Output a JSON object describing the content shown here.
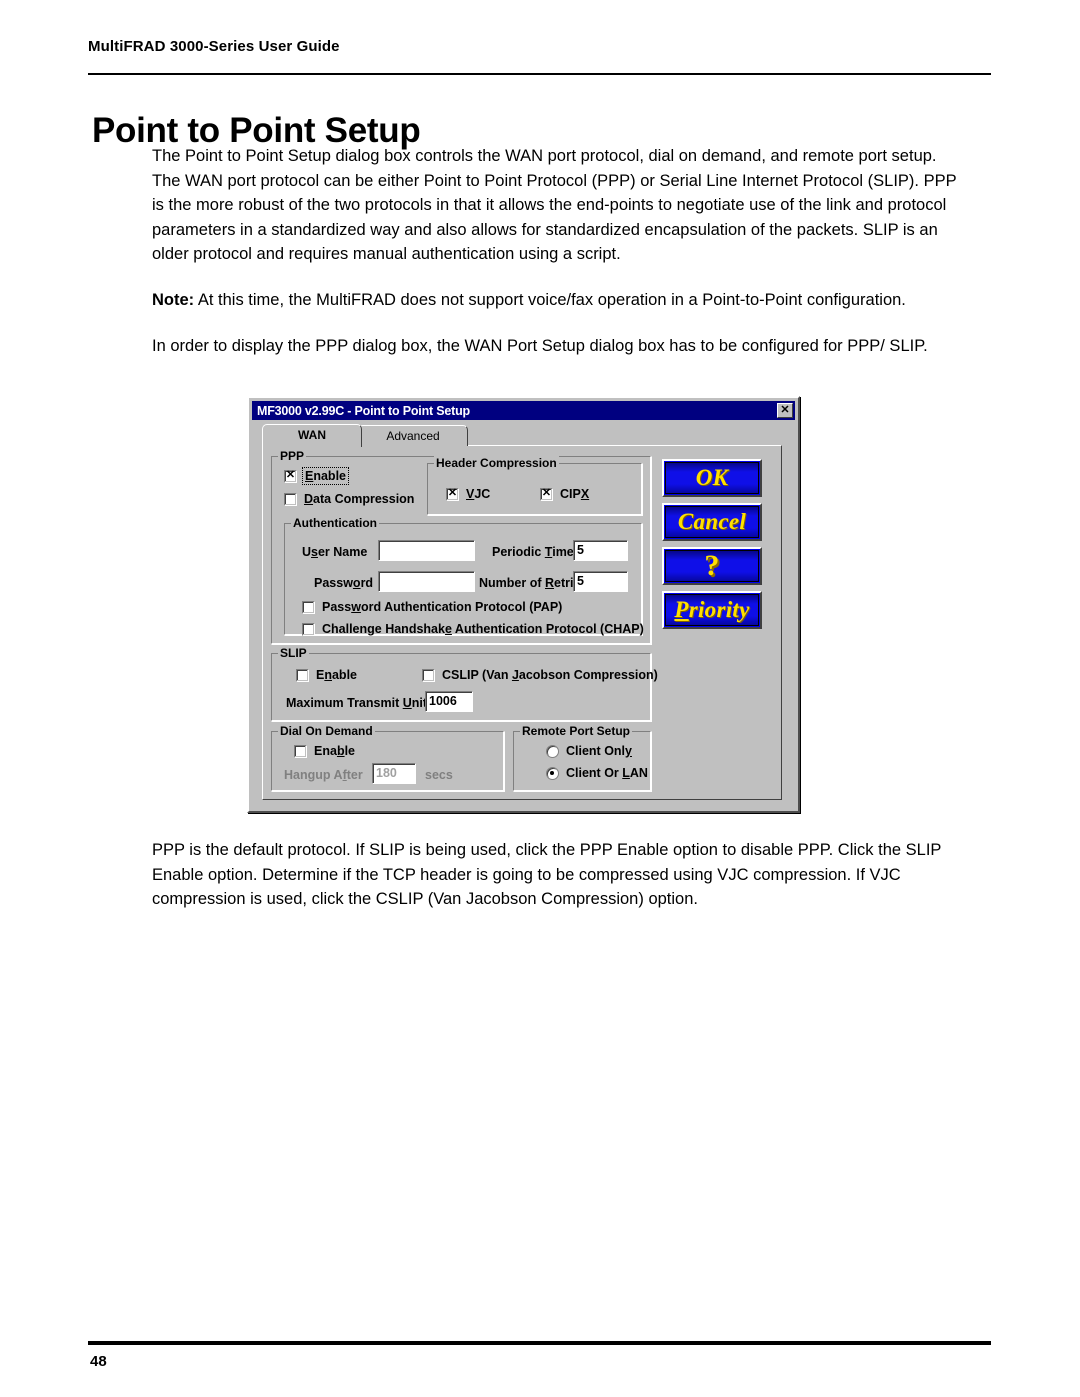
{
  "page": {
    "header": "MultiFRAD 3000-Series User Guide",
    "title": "Point to Point Setup",
    "number": "48"
  },
  "paragraphs": {
    "p1": "The Point to Point Setup dialog box controls the WAN port protocol, dial on demand, and remote port setup.  The WAN port protocol can be either Point to Point Protocol (PPP) or Serial Line Internet Protocol (SLIP).  PPP is the more robust of the two protocols in that it allows the end-points to negotiate use of the link and protocol parameters in a standardized way and also allows for standardized encapsulation of the packets.  SLIP is an older protocol and requires manual authentication using a script.",
    "p2_label": "Note:",
    "p2": "At this time, the MultiFRAD does not support voice/fax operation in a Point-to-Point configuration.",
    "p3": "In order to display the PPP dialog box, the WAN Port Setup dialog box has to be configured for PPP/ SLIP.",
    "p4": "PPP is the default protocol.  If SLIP is being used, click the PPP Enable option to disable PPP. Click the SLIP Enable option. Determine if the TCP header is going to be compressed using VJC compression. If VJC compression is used, click the CSLIP (Van Jacobson Compression) option."
  },
  "dialog": {
    "title": "MF3000 v2.99C - Point to Point Setup",
    "close_icon": "✕",
    "tabs": [
      {
        "label_pre": "W",
        "label_key": "A",
        "label_post": "N",
        "label": "WAN",
        "selected": true
      },
      {
        "label_key": "A",
        "label_post": "dvanced",
        "label": "Advanced",
        "selected": false
      }
    ],
    "ppp": {
      "legend": "PPP",
      "enable": {
        "label": "Enable",
        "checked": true
      },
      "data_compression": {
        "label": "Data Compression",
        "checked": false
      },
      "header_compression": {
        "legend": "Header Compression",
        "vjc": {
          "label": "VJC",
          "checked": true
        },
        "cipx": {
          "label": "CIPX",
          "checked": true
        }
      },
      "authentication": {
        "legend": "Authentication",
        "user_name_label": "User Name",
        "user_name_value": "",
        "password_label": "Password",
        "password_value": "",
        "periodic_timer_label": "Periodic Timer",
        "periodic_timer_value": "5",
        "number_of_retries_label": "Number of Retries",
        "number_of_retries_value": "5",
        "pap": {
          "label": "Password Authentication Protocol (PAP)",
          "checked": false
        },
        "chap": {
          "label": "Challenge Handshake Authentication Protocol (CHAP)",
          "checked": false
        }
      }
    },
    "slip": {
      "legend": "SLIP",
      "enable": {
        "label": "Enable",
        "checked": false
      },
      "cslip": {
        "label": "CSLIP (Van Jacobson Compression)",
        "checked": false
      },
      "mtu_label": "Maximum Transmit Unit",
      "mtu_value": "1006"
    },
    "dial_on_demand": {
      "legend": "Dial On Demand",
      "enable": {
        "label": "Enable",
        "checked": false
      },
      "hangup_label": "Hangup After",
      "hangup_value": "180",
      "hangup_units": "secs",
      "disabled": true
    },
    "remote_port_setup": {
      "legend": "Remote Port Setup",
      "client_only": {
        "label": "Client Only",
        "selected": false
      },
      "client_or_lan": {
        "label": "Client Or LAN",
        "selected": true
      }
    },
    "buttons": [
      {
        "label": "OK"
      },
      {
        "label": "Cancel"
      },
      {
        "label": "?"
      },
      {
        "label": "Priority"
      }
    ],
    "colors": {
      "titlebar": "#000080",
      "face": "#c0c0c0",
      "button_face": "#0f0fe8",
      "button_text": "#ffe000"
    }
  }
}
